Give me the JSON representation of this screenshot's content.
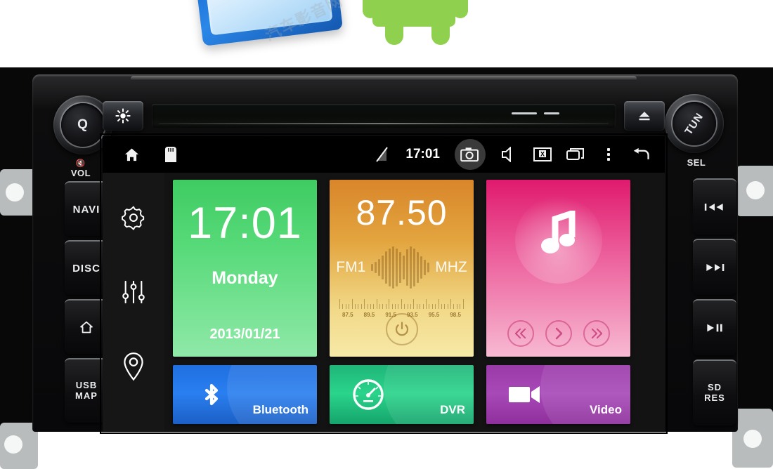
{
  "banner": {
    "watermark": "汽车影音网"
  },
  "statusbar": {
    "time": "17:01",
    "icons": {
      "home": "home-icon",
      "sdcard": "sd-card-icon",
      "signal_off": "signal-off-icon",
      "camera": "camera-icon",
      "volume": "volume-icon",
      "screenshot": "screenshot-icon",
      "recents": "recents-icon",
      "overflow": "overflow-menu-icon",
      "back": "back-arrow-icon"
    }
  },
  "sidebar": {
    "items": [
      {
        "icon": "gear-icon",
        "name": "settings"
      },
      {
        "icon": "equalizer-icon",
        "name": "equalizer"
      },
      {
        "icon": "location-pin-icon",
        "name": "navigation"
      }
    ]
  },
  "tiles": {
    "clock": {
      "time": "17:01",
      "day": "Monday",
      "date": "2013/01/21",
      "color": "#3fcb62"
    },
    "radio": {
      "frequency": "87.50",
      "band": "FM1",
      "unit": "MHZ",
      "color": "#d9862a",
      "scale_labels": [
        "87.5",
        "89.5",
        "91.5",
        "93.5",
        "95.5",
        "98.5"
      ],
      "power_icon": "power-icon"
    },
    "music": {
      "icon": "music-note-icon",
      "color": "#e01a6e",
      "controls": [
        {
          "name": "previous",
          "icon": "skip-previous-icon"
        },
        {
          "name": "play",
          "icon": "play-icon"
        },
        {
          "name": "next",
          "icon": "skip-next-icon"
        }
      ]
    },
    "bluetooth": {
      "label": "Bluetooth",
      "icon": "bluetooth-icon",
      "color": "#2a7ff0"
    },
    "dvr": {
      "label": "DVR",
      "icon": "speedometer-icon",
      "color": "#2ad48b"
    },
    "video": {
      "label": "Video",
      "icon": "video-camera-icon",
      "color": "#a849b8"
    }
  },
  "hardware": {
    "knob_left": {
      "label": "Q",
      "sub_mute": "MUTE",
      "sub": "VOL"
    },
    "knob_right": {
      "label": "TUN",
      "sub": "SEL"
    },
    "buttons_left": [
      {
        "label": "NAVI"
      },
      {
        "label": "DISC"
      },
      {
        "label": "",
        "icon": "home-icon"
      },
      {
        "label": "USB",
        "label2": "MAP"
      }
    ],
    "buttons_right": [
      {
        "label": "",
        "icon": "skip-previous-icon"
      },
      {
        "label": "",
        "icon": "skip-next-icon"
      },
      {
        "label": "",
        "icon": "play-pause-icon"
      },
      {
        "label": "SD",
        "label2": "RES"
      }
    ],
    "top": {
      "brightness_icon": "brightness-icon",
      "eject_icon": "eject-icon"
    }
  }
}
